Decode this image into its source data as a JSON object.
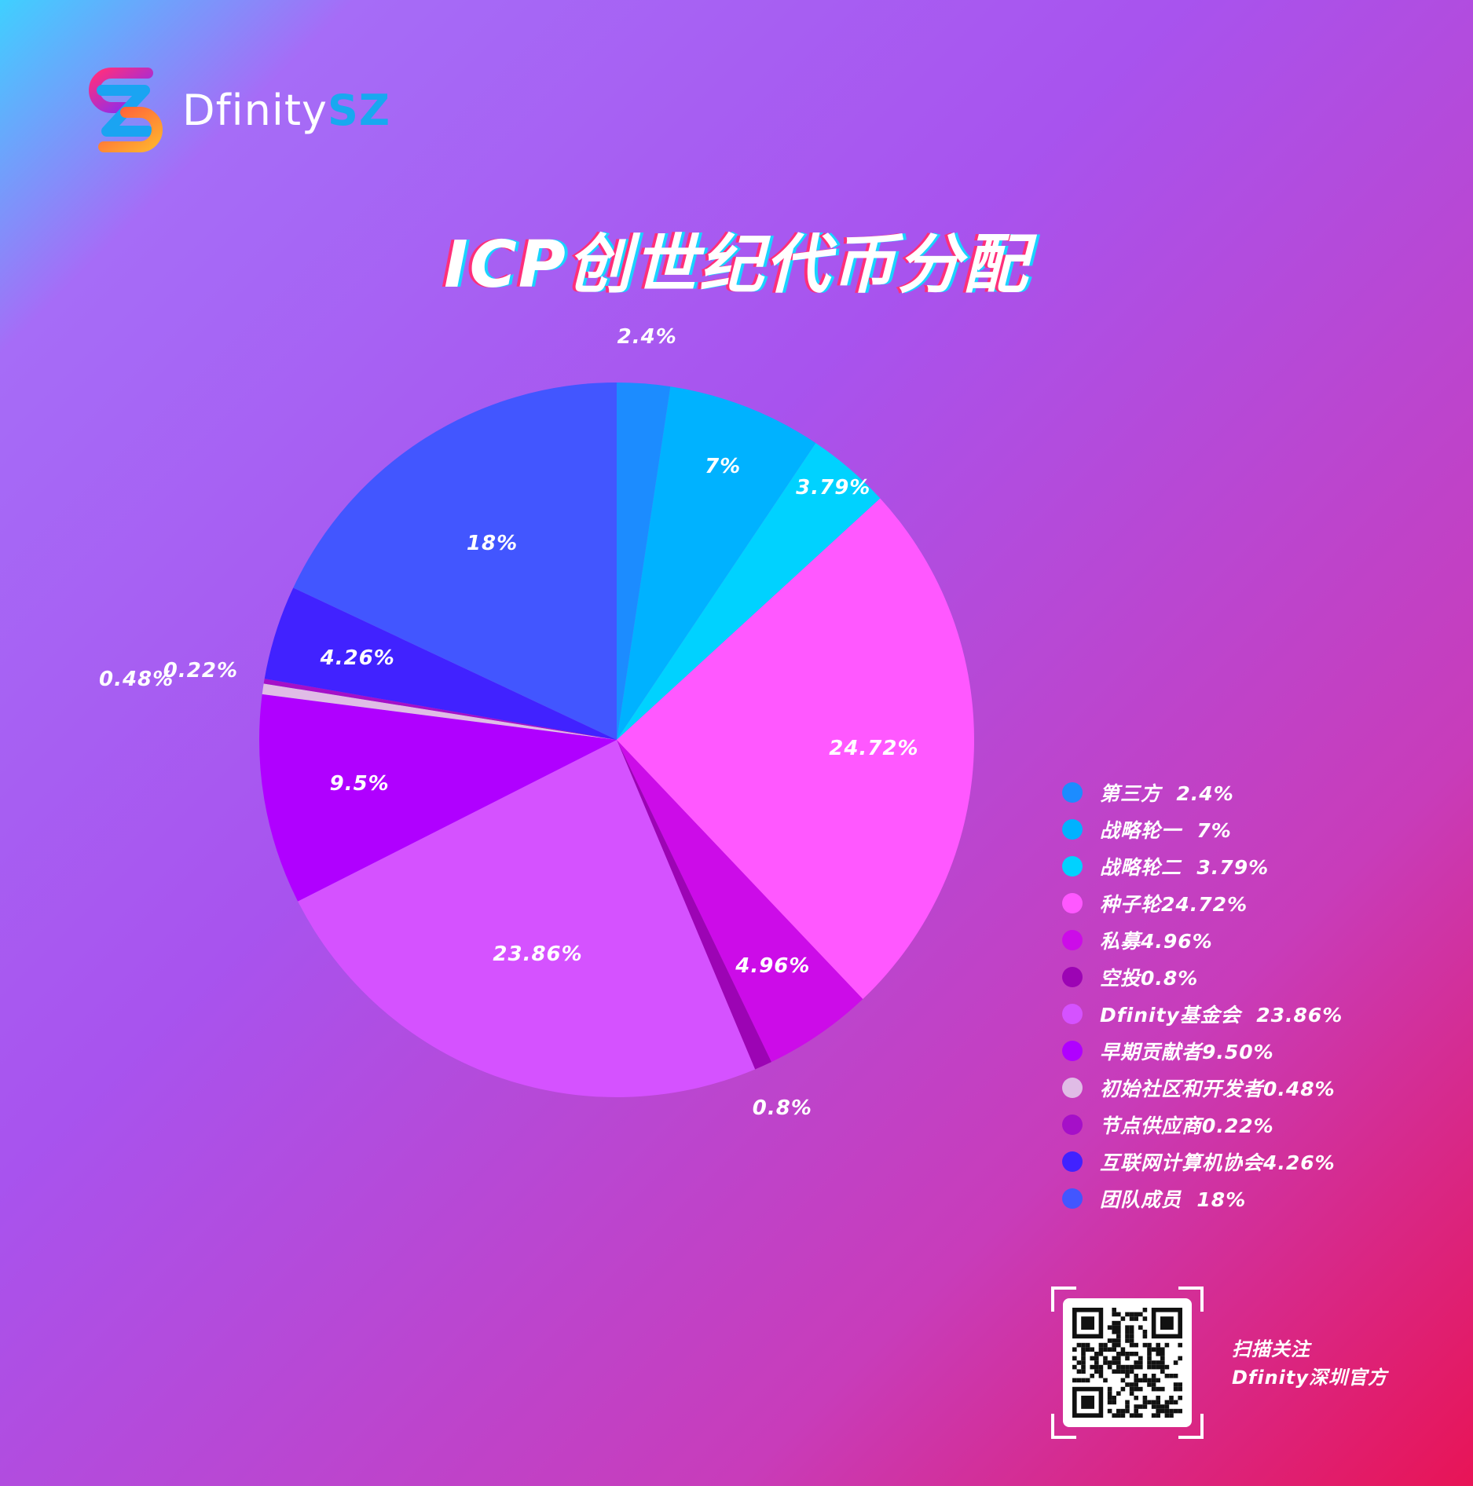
{
  "brand": {
    "name_plain": "Dfinity",
    "name_accent": "SZ"
  },
  "title": "ICP创世纪代币分配",
  "chart_data": {
    "type": "pie",
    "title": "ICP创世纪代币分配",
    "start_angle_deg": 0,
    "direction": "clockwise",
    "slices": [
      {
        "label": "2.4%",
        "value": 2.4,
        "color": "#1c8cff"
      },
      {
        "label": "7%",
        "value": 7.0,
        "color": "#00b2ff"
      },
      {
        "label": "3.79%",
        "value": 3.79,
        "color": "#00d2ff"
      },
      {
        "label": "24.72%",
        "value": 24.72,
        "color": "#ff58ff"
      },
      {
        "label": "4.96%",
        "value": 4.96,
        "color": "#cc0ce8"
      },
      {
        "label": "0.8%",
        "value": 0.8,
        "color": "#9c04b4"
      },
      {
        "label": "23.86%",
        "value": 23.86,
        "color": "#d552ff"
      },
      {
        "label": "9.5%",
        "value": 9.5,
        "color": "#b000ff"
      },
      {
        "label": "0.48%",
        "value": 0.48,
        "color": "#e0bce6"
      },
      {
        "label": "0.22%",
        "value": 0.22,
        "color": "#a510c8"
      },
      {
        "label": "4.26%",
        "value": 4.26,
        "color": "#4122ff"
      },
      {
        "label": "18%",
        "value": 18.0,
        "color": "#4256ff"
      }
    ],
    "legend": [
      {
        "text": "第三方  2.4%",
        "color": "#1c8cff"
      },
      {
        "text": "战略轮一  7%",
        "color": "#00b2ff"
      },
      {
        "text": "战略轮二  3.79%",
        "color": "#00d2ff"
      },
      {
        "text": "种子轮24.72%",
        "color": "#ff58ff"
      },
      {
        "text": "私募4.96%",
        "color": "#cc0ce8"
      },
      {
        "text": "空投0.8%",
        "color": "#9c04b4"
      },
      {
        "text": "Dfinity基金会  23.86%",
        "color": "#d552ff"
      },
      {
        "text": "早期贡献者9.50%",
        "color": "#b000ff"
      },
      {
        "text": "初始社区和开发者0.48%",
        "color": "#e0bce6"
      },
      {
        "text": "节点供应商0.22%",
        "color": "#a510c8"
      },
      {
        "text": "互联网计算机协会4.26%",
        "color": "#4122ff"
      },
      {
        "text": "团队成员  18%",
        "color": "#4256ff"
      }
    ],
    "legend_position": "right"
  },
  "qr": {
    "caption_line1": "扫描关注",
    "caption_line2": "Dfinity深圳官方"
  },
  "colors": {
    "title_shadow_left": "#ff2f7a",
    "title_shadow_right": "#19d3ff",
    "brand_accent": "#18a8f0"
  }
}
